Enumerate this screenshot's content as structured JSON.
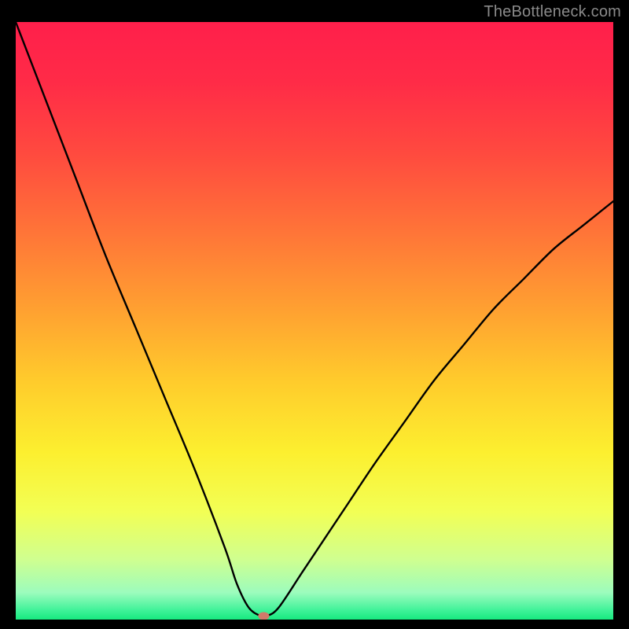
{
  "watermark": "TheBottleneck.com",
  "chart_data": {
    "type": "line",
    "title": "",
    "xlabel": "",
    "ylabel": "",
    "xlim": [
      0,
      100
    ],
    "ylim": [
      0,
      100
    ],
    "grid": false,
    "legend": false,
    "annotations": [],
    "series": [
      {
        "name": "curve",
        "x": [
          0,
          5,
          10,
          15,
          20,
          25,
          30,
          35,
          37,
          39,
          41,
          42,
          44,
          48,
          52,
          56,
          60,
          65,
          70,
          75,
          80,
          85,
          90,
          95,
          100
        ],
        "y": [
          100,
          87,
          74,
          61,
          49,
          37,
          25,
          12,
          6,
          2,
          0.6,
          0.6,
          2,
          8,
          14,
          20,
          26,
          33,
          40,
          46,
          52,
          57,
          62,
          66,
          70
        ]
      }
    ],
    "marker": {
      "x": 41.5,
      "y": 0.6,
      "color": "#d07a6a"
    },
    "background_gradient": {
      "stops": [
        {
          "offset": 0.0,
          "color": "#ff1f4b"
        },
        {
          "offset": 0.1,
          "color": "#ff2b47"
        },
        {
          "offset": 0.22,
          "color": "#ff4a3f"
        },
        {
          "offset": 0.35,
          "color": "#ff7438"
        },
        {
          "offset": 0.48,
          "color": "#ffa031"
        },
        {
          "offset": 0.6,
          "color": "#ffcb2c"
        },
        {
          "offset": 0.72,
          "color": "#fcef2f"
        },
        {
          "offset": 0.82,
          "color": "#f2ff55"
        },
        {
          "offset": 0.9,
          "color": "#cfff90"
        },
        {
          "offset": 0.955,
          "color": "#9cfcbd"
        },
        {
          "offset": 0.985,
          "color": "#3ef298"
        },
        {
          "offset": 1.0,
          "color": "#17e97f"
        }
      ]
    }
  }
}
